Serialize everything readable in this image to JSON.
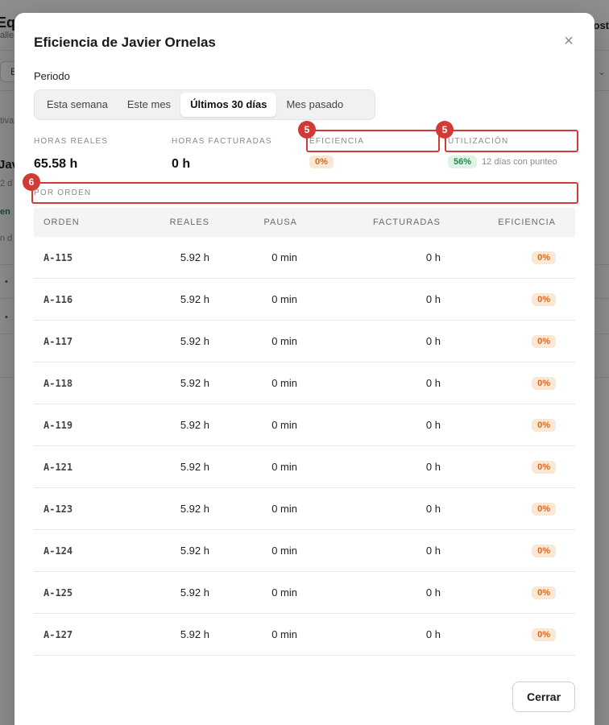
{
  "background": {
    "title": "Eq",
    "subtitle": "alle",
    "right_label": "ost",
    "filter_chip": "E",
    "text_1": "tiva",
    "name": "Jav",
    "name_sub": "2 d",
    "green_text": "en",
    "text_2": "n d"
  },
  "modal": {
    "title": "Eficiencia de Javier Ornelas",
    "close_glyph": "×",
    "period_label": "Periodo",
    "periods": [
      "Esta semana",
      "Este mes",
      "Últimos 30 días",
      "Mes pasado"
    ],
    "active_period": "Últimos 30 días",
    "stats": {
      "hours_real_label": "HORAS REALES",
      "hours_real_value": "65.58 h",
      "hours_billed_label": "HORAS FACTURADAS",
      "hours_billed_value": "0 h",
      "efficiency_label": "EFICIENCIA",
      "efficiency_value": "0%",
      "utilization_label": "UTILIZACIÓN",
      "utilization_value": "56%",
      "utilization_note": "12 días con punteo"
    },
    "annotations": {
      "badge_a": "5",
      "badge_b": "5",
      "badge_c": "6"
    },
    "section_label": "POR ORDEN",
    "table": {
      "headers": [
        "ORDEN",
        "REALES",
        "PAUSA",
        "FACTURADAS",
        "EFICIENCIA"
      ],
      "rows": [
        {
          "orden": "A-115",
          "reales": "5.92 h",
          "pausa": "0 min",
          "facturadas": "0 h",
          "eficiencia": "0%"
        },
        {
          "orden": "A-116",
          "reales": "5.92 h",
          "pausa": "0 min",
          "facturadas": "0 h",
          "eficiencia": "0%"
        },
        {
          "orden": "A-117",
          "reales": "5.92 h",
          "pausa": "0 min",
          "facturadas": "0 h",
          "eficiencia": "0%"
        },
        {
          "orden": "A-118",
          "reales": "5.92 h",
          "pausa": "0 min",
          "facturadas": "0 h",
          "eficiencia": "0%"
        },
        {
          "orden": "A-119",
          "reales": "5.92 h",
          "pausa": "0 min",
          "facturadas": "0 h",
          "eficiencia": "0%"
        },
        {
          "orden": "A-121",
          "reales": "5.92 h",
          "pausa": "0 min",
          "facturadas": "0 h",
          "eficiencia": "0%"
        },
        {
          "orden": "A-123",
          "reales": "5.92 h",
          "pausa": "0 min",
          "facturadas": "0 h",
          "eficiencia": "0%"
        },
        {
          "orden": "A-124",
          "reales": "5.92 h",
          "pausa": "0 min",
          "facturadas": "0 h",
          "eficiencia": "0%"
        },
        {
          "orden": "A-125",
          "reales": "5.92 h",
          "pausa": "0 min",
          "facturadas": "0 h",
          "eficiencia": "0%"
        },
        {
          "orden": "A-127",
          "reales": "5.92 h",
          "pausa": "0 min",
          "facturadas": "0 h",
          "eficiencia": "0%"
        }
      ]
    },
    "close_button": "Cerrar"
  },
  "colors": {
    "accent_highlight": "#d23a35",
    "efficiency_pill_bg": "#fbe7d5",
    "efficiency_pill_text": "#d26a1d",
    "utilization_pill_bg": "#dff3e6",
    "utilization_pill_text": "#1e8a4c"
  }
}
